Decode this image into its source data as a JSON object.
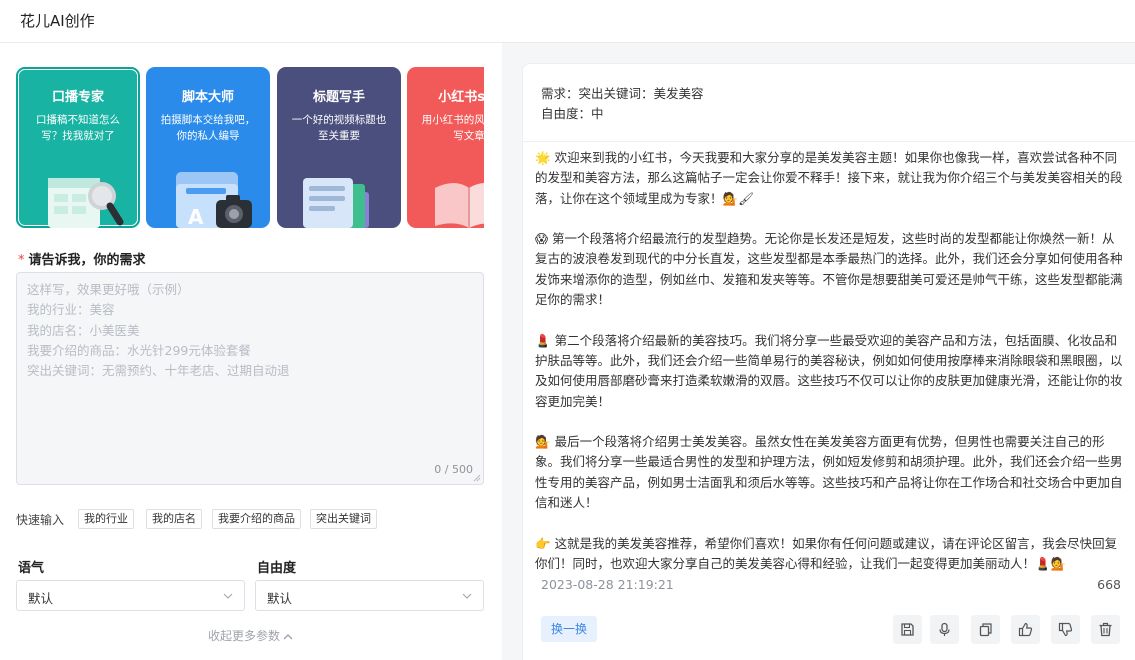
{
  "app": {
    "title": "花儿AI创作"
  },
  "cards": [
    {
      "title": "口播专家",
      "desc": "口播稿不知道怎么写？找我就对了",
      "color": "#19b3a3",
      "icon": "template-microphone-icon"
    },
    {
      "title": "脚本大师",
      "desc": "拍摄脚本交给我吧，你的私人编导",
      "color": "#2b8bea",
      "icon": "folder-camera-icon"
    },
    {
      "title": "标题写手",
      "desc": "一个好的视频标题也至关重要",
      "color": "#4b4f7d",
      "icon": "documents-icon"
    },
    {
      "title": "小红书sty",
      "desc": "用小红书的风格给你写文章",
      "color": "#f25a5a",
      "icon": "book-pen-icon"
    }
  ],
  "form": {
    "request_label": "请告诉我，你的需求",
    "required_mark": "*",
    "placeholder_lines": [
      "这样写，效果更好哦（示例）",
      "我的行业：美容",
      "我的店名：小美医美",
      "我要介绍的商品：水光针299元体验套餐",
      "突出关键词：无需预约、十年老店、过期自动退"
    ],
    "counter": "0 / 500",
    "quick_label": "快速输入",
    "quick_tags": [
      "我的行业",
      "我的店名",
      "我要介绍的商品",
      "突出关键词"
    ],
    "tone_label": "语气",
    "tone_value": "默认",
    "freedom_label": "自由度",
    "freedom_value": "默认",
    "collapse_label": "收起更多参数"
  },
  "result": {
    "requirement_line": "需求：突出关键词：美发美容",
    "freedom_line": "自由度：中",
    "paragraphs": [
      {
        "emoji": "🌟",
        "text": "欢迎来到我的小红书，今天我要和大家分享的是美发美容主题！如果你也像我一样，喜欢尝试各种不同的发型和美容方法，那么这篇帖子一定会让你爱不释手！接下来，就让我为你介绍三个与美发美容相关的段落，让你在这个领域里成为专家！",
        "tail": "💁🖌"
      },
      {
        "emoji": "😱",
        "text": "第一个段落将介绍最流行的发型趋势。无论你是长发还是短发，这些时尚的发型都能让你焕然一新！从复古的波浪卷发到现代的中分长直发，这些发型都是本季最热门的选择。此外，我们还会分享如何使用各种发饰来增添你的造型，例如丝巾、发箍和发夹等等。不管你是想要甜美可爱还是帅气干练，这些发型都能满足你的需求！",
        "tail": ""
      },
      {
        "emoji": "💄",
        "text": "第二个段落将介绍最新的美容技巧。我们将分享一些最受欢迎的美容产品和方法，包括面膜、化妆品和护肤品等等。此外，我们还会介绍一些简单易行的美容秘诀，例如如何使用按摩棒来消除眼袋和黑眼圈，以及如何使用唇部磨砂膏来打造柔软嫩滑的双唇。这些技巧不仅可以让你的皮肤更加健康光滑，还能让你的妆容更加完美！",
        "tail": ""
      },
      {
        "emoji": "💁",
        "text": "最后一个段落将介绍男士美发美容。虽然女性在美发美容方面更有优势，但男性也需要关注自己的形象。我们将分享一些最适合男性的发型和护理方法，例如短发修剪和胡须护理。此外，我们还会介绍一些男性专用的美容产品，例如男士洁面乳和须后水等等。这些技巧和产品将让你在工作场合和社交场合中更加自信和迷人！",
        "tail": ""
      },
      {
        "emoji": "👉",
        "text": "这就是我的美发美容推荐，希望你们喜欢！如果你有任何问题或建议，请在评论区留言，我会尽快回复你们！同时，也欢迎大家分享自己的美发美容心得和经验，让我们一起变得更加美丽动人！",
        "tail": "💄💁"
      }
    ],
    "timestamp": "2023-08-28 21:19:21",
    "char_count": "668",
    "swap_label": "换一换",
    "actions": [
      "save-icon",
      "microphone-icon",
      "copy-icon",
      "thumbs-up-icon",
      "thumbs-down-icon",
      "trash-icon"
    ]
  }
}
